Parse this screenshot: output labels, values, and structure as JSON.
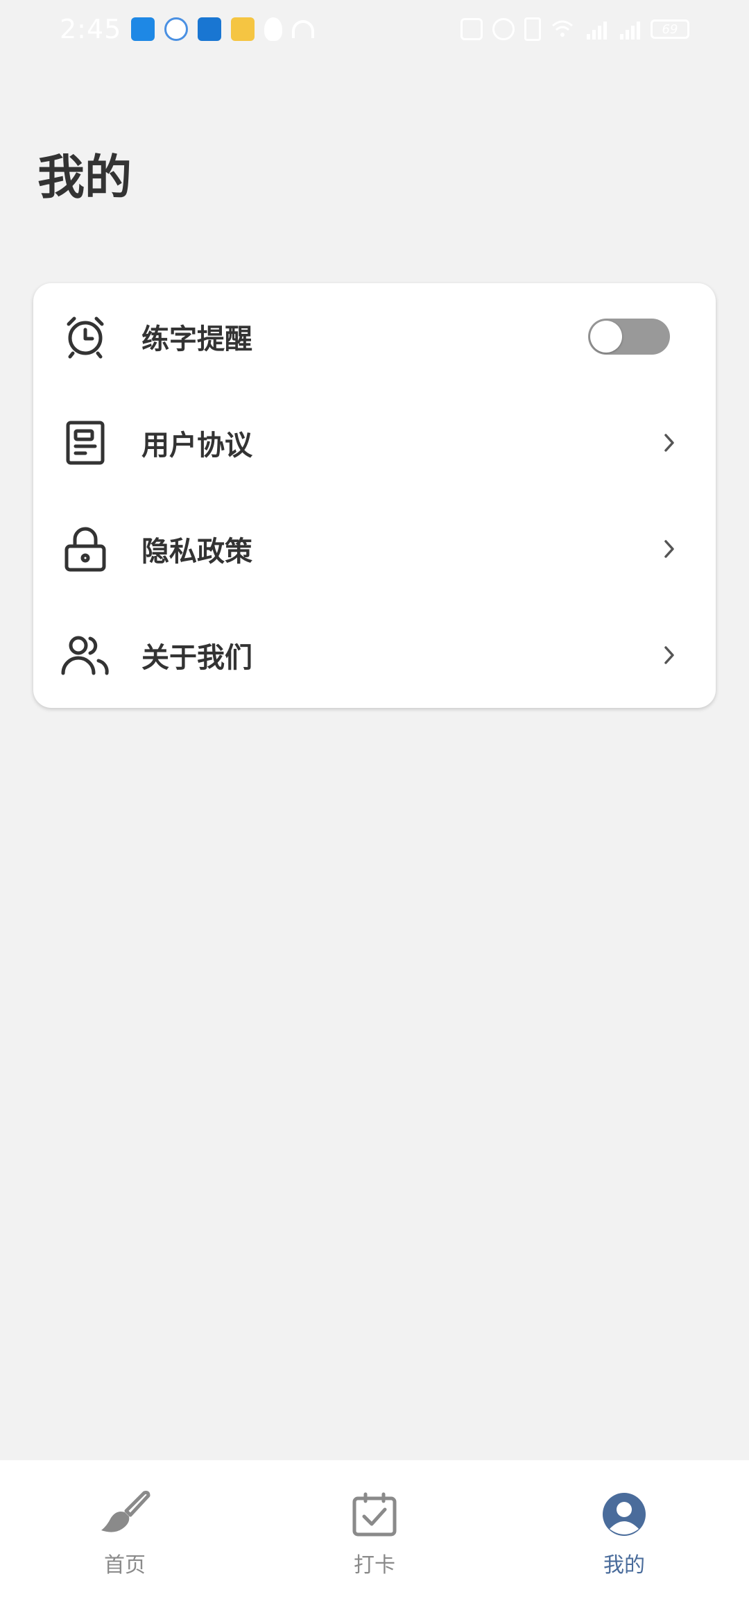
{
  "status_bar": {
    "time": "2:45",
    "battery": "69"
  },
  "page": {
    "title": "我的"
  },
  "settings": {
    "items": [
      {
        "label": "练字提醒",
        "icon": "alarm-clock-icon",
        "control": "toggle",
        "toggle_on": false
      },
      {
        "label": "用户协议",
        "icon": "document-icon",
        "control": "chevron"
      },
      {
        "label": "隐私政策",
        "icon": "lock-icon",
        "control": "chevron"
      },
      {
        "label": "关于我们",
        "icon": "users-icon",
        "control": "chevron"
      }
    ]
  },
  "tabbar": {
    "tabs": [
      {
        "label": "首页",
        "icon": "brush-icon",
        "active": false
      },
      {
        "label": "打卡",
        "icon": "calendar-check-icon",
        "active": false
      },
      {
        "label": "我的",
        "icon": "profile-icon",
        "active": true
      }
    ]
  },
  "colors": {
    "background": "#f2f2f2",
    "card": "#ffffff",
    "text": "#333333",
    "tab_inactive": "#8a8a8a",
    "tab_active": "#4a6c9b",
    "toggle_off": "#999999"
  }
}
